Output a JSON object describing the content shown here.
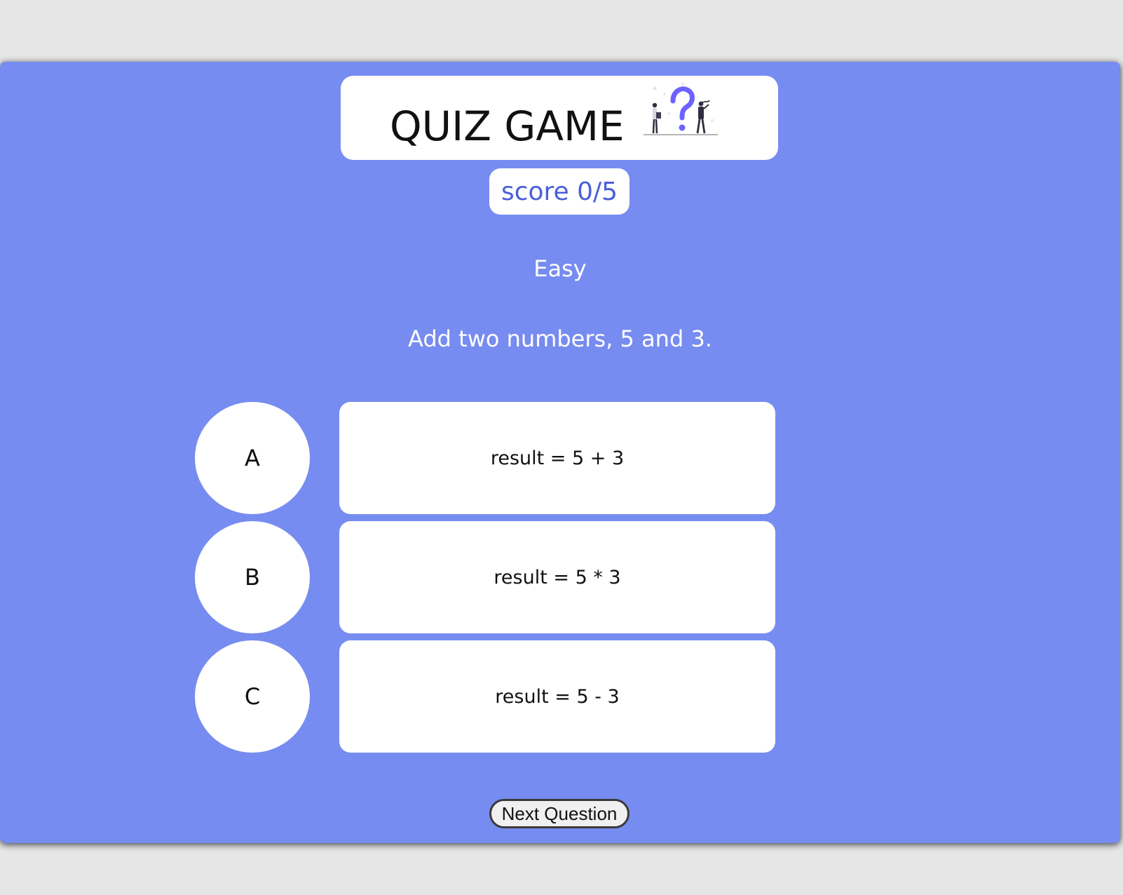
{
  "app": {
    "title": "QUIZ GAME",
    "title_illustration_icon": "question-mark-people-illustration-icon"
  },
  "score": {
    "text": "score 0/5"
  },
  "question": {
    "difficulty": "Easy",
    "text": "Add two numbers, 5 and 3."
  },
  "answers": [
    {
      "letter": "A",
      "text": "result = 5 + 3"
    },
    {
      "letter": "B",
      "text": "result = 5 * 3"
    },
    {
      "letter": "C",
      "text": "result = 5 - 3"
    }
  ],
  "controls": {
    "next_label": "Next Question"
  },
  "colors": {
    "panel_background": "#778cf0",
    "page_background": "#e6e6e6",
    "card_background": "#ffffff",
    "score_text": "#4a5fdb",
    "illustration_accent": "#6c63ff"
  }
}
